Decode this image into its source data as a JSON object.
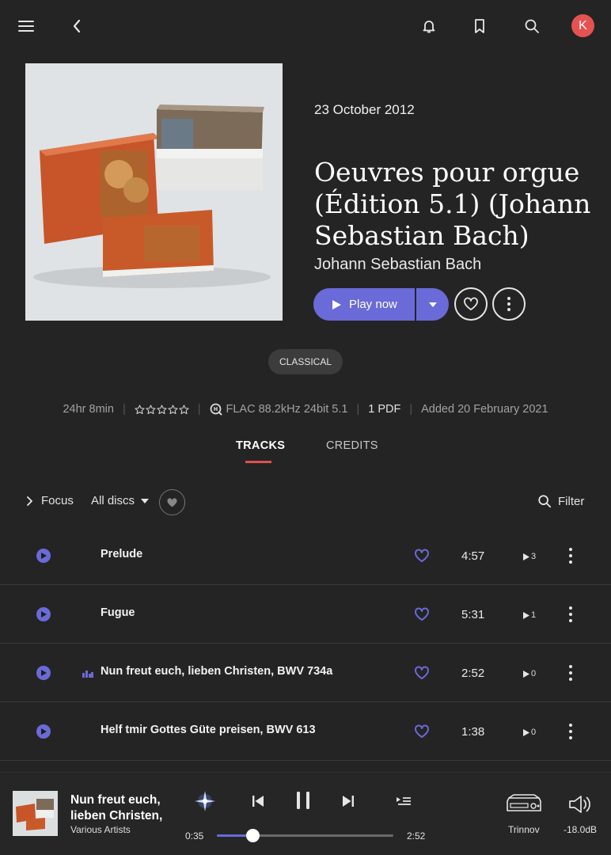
{
  "album": {
    "date": "23 October 2012",
    "title": "Oeuvres pour orgue (Édition 5.1) (Johann Sebastian Bach)",
    "artist": "Johann Sebastian Bach",
    "play_label": "Play now",
    "genre": "CLASSICAL"
  },
  "meta": {
    "duration": "24hr 8min",
    "rating_stars": 5,
    "format": "FLAC 88.2kHz 24bit 5.1",
    "pdf": "1 PDF",
    "added": "Added 20 February 2021"
  },
  "tabs": [
    {
      "label": "TRACKS",
      "active": true
    },
    {
      "label": "CREDITS",
      "active": false
    }
  ],
  "toolbar": {
    "focus": "Focus",
    "discs": "All discs",
    "filter": "Filter"
  },
  "tracks": [
    {
      "name": "Prelude",
      "duration": "4:57",
      "plays": "3",
      "now_playing": false
    },
    {
      "name": "Fugue",
      "duration": "5:31",
      "plays": "1",
      "now_playing": false
    },
    {
      "name": "Nun freut euch, lieben Christen, BWV 734a",
      "duration": "2:52",
      "plays": "0",
      "now_playing": true
    },
    {
      "name": "Helf tmir Gottes Güte preisen, BWV 613",
      "duration": "1:38",
      "plays": "0",
      "now_playing": false
    }
  ],
  "player": {
    "title": "Nun freut euch, lieben Christen,",
    "artist": "Various Artists",
    "elapsed": "0:35",
    "total": "2:52",
    "progress_fraction": 0.2,
    "device": "Trinnov",
    "volume": "-18.0dB"
  },
  "user": {
    "initial": "K"
  },
  "colors": {
    "accent": "#6a6ad8",
    "avatar": "#e55252",
    "tab_underline": "#e0504c",
    "background": "#242424"
  }
}
